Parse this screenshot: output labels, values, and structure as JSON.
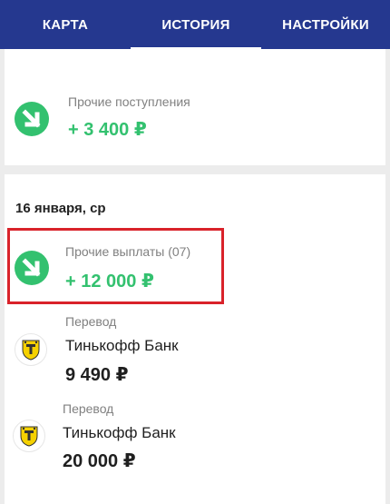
{
  "tabs": [
    {
      "label": "КАРТА"
    },
    {
      "label": "ИСТОРИЯ"
    },
    {
      "label": "НАСТРОЙКИ"
    }
  ],
  "transactions_top": [
    {
      "category": "Прочие поступления",
      "amount": "+ 3 400 ₽"
    }
  ],
  "date_group": {
    "date": "16 января, ср",
    "items": [
      {
        "category": "Прочие выплаты (07)",
        "amount": "+ 12 000 ₽"
      },
      {
        "category": "Перевод",
        "merchant": "Тинькофф Банк",
        "amount": "9 490 ₽"
      },
      {
        "category": "Перевод",
        "merchant": "Тинькофф Банк",
        "amount": "20 000 ₽"
      }
    ]
  },
  "colors": {
    "header_bg": "#25388f",
    "accent_green": "#33c16f",
    "highlight_red": "#d9222a",
    "logo_yellow": "#f5d100"
  }
}
